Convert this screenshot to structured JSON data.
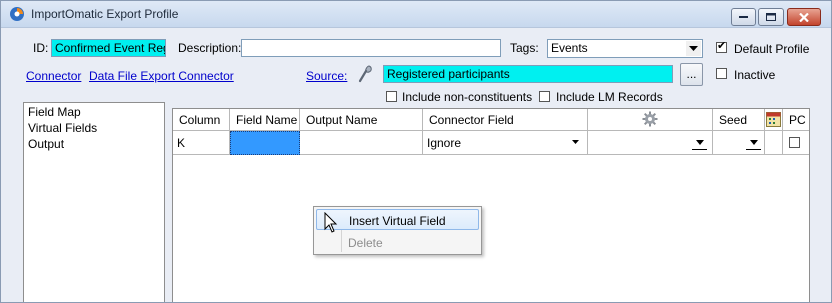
{
  "window": {
    "title": "ImportOmatic Export Profile",
    "icons": [
      "app-icon",
      "minimize-icon",
      "maximize-icon",
      "close-icon"
    ]
  },
  "profile": {
    "id_label": "ID:",
    "id_value": "Confirmed Event Reg",
    "description_label": "Description:",
    "description_value": "",
    "tags_label": "Tags:",
    "tags_value": "Events",
    "default_profile_label": "Default Profile",
    "default_profile_checked": true,
    "inactive_label": "Inactive",
    "inactive_checked": false
  },
  "links": {
    "connector": "Connector",
    "data_file_export_connector": "Data File Export Connector"
  },
  "source": {
    "label": "Source:",
    "value": "Registered participants",
    "browse_label": "...",
    "include_non_constituents_label": "Include non-constituents",
    "include_non_constituents_checked": false,
    "include_lm_records_label": "Include LM Records",
    "include_lm_records_checked": false
  },
  "sidebar": {
    "items": [
      {
        "label": "Field Map"
      },
      {
        "label": "Virtual Fields"
      },
      {
        "label": "Output"
      }
    ]
  },
  "grid": {
    "columns": [
      "Column",
      "Field Name",
      "Output Name",
      "Connector Field",
      "",
      "Seed",
      "",
      "PC"
    ],
    "column_icons": [
      "gear-icon",
      "calendar-icon"
    ],
    "rows": [
      {
        "column": "K",
        "field_name": "",
        "output_name": "",
        "connector_field": "Ignore",
        "settings": "",
        "seed": ""
      }
    ]
  },
  "context_menu": {
    "items": [
      {
        "label": "Insert Virtual Field",
        "enabled": true
      },
      {
        "label": "Delete",
        "enabled": false
      }
    ]
  },
  "colors": {
    "highlight_field": "#00f0f0",
    "selected_cell": "#3399ff",
    "link": "#0000cc"
  }
}
